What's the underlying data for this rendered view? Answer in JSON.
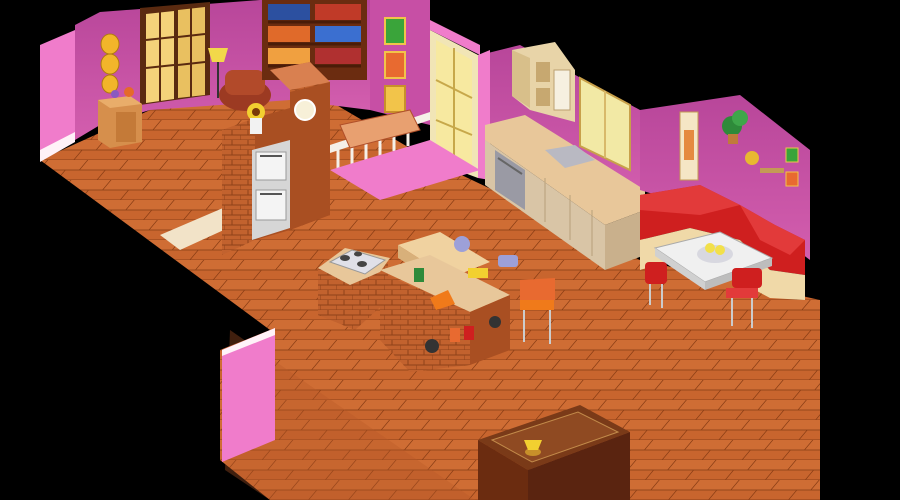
{
  "scene": {
    "type": "isometric-room",
    "rooms": [
      "living-area",
      "kitchen",
      "dining-nook"
    ],
    "colors": {
      "background": "#000000",
      "wall": "#c04b9a",
      "wall_light": "#e05fb8",
      "wall_side": "#f07ccb",
      "floor": "#c8652e",
      "floor_dark": "#a9501f",
      "floor_line": "#8c3f16",
      "brick": "#c2622e",
      "brick_dark": "#8f4219",
      "booth_red": "#cf1f1f",
      "counter_top": "#e8c79a",
      "cabinet": "#e3d1b6",
      "wood_dark": "#5a2a10",
      "shelf_books": "#3b5fa8"
    },
    "objects": [
      "french-doors",
      "gold-plates",
      "side-cabinet",
      "floor-lamp",
      "armchair",
      "bookshelf",
      "brick-fireplace",
      "wall-ovens",
      "stair-railing",
      "rug",
      "sliding-door",
      "wall-cabinets",
      "sink-counter",
      "dishwasher",
      "window",
      "plant",
      "booth-seat",
      "dining-table",
      "red-chairs",
      "cooking-island",
      "bar-stools",
      "coffee-table",
      "table-lamp"
    ]
  }
}
